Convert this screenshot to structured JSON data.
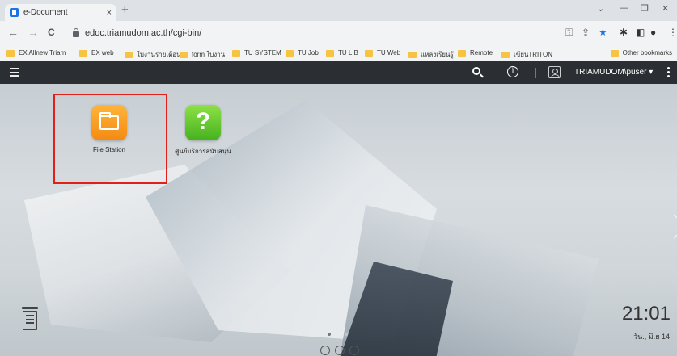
{
  "browser": {
    "tab": {
      "title": "e-Document",
      "close": "×"
    },
    "new_tab": "+",
    "window_controls": {
      "minimize": "—",
      "restore": "❐",
      "close": "✕"
    },
    "nav": {
      "back": "←",
      "forward": "→",
      "reload": "C"
    },
    "url": "edoc.triamudom.ac.th/cgi-bin/",
    "bookmarks": [
      "EX Allnew Triam",
      "EX web",
      "ใบงานรายเดือน",
      "form ใบงาน",
      "TU SYSTEM",
      "TU Job",
      "TU LIB",
      "TU Web",
      "แหล่งเรียนรู้",
      "Remote",
      "เขียนTRITON"
    ],
    "other_bookmarks": "Other bookmarks"
  },
  "dsm": {
    "username": "TRIAMUDOM\\puser ▾",
    "info_symbol": "i",
    "apps": [
      {
        "label": "File Station"
      },
      {
        "label": "ศูนย์บริการสนับสนุน",
        "glyph": "?"
      }
    ],
    "clock": {
      "time": "21:01",
      "date": "วัน., มิ.ย 14"
    }
  },
  "colors": {
    "highlight_border": "#e0201a",
    "dsm_bar": "#2b2f33",
    "file_station_tile": "#f48a12",
    "support_tile": "#45b21e"
  }
}
